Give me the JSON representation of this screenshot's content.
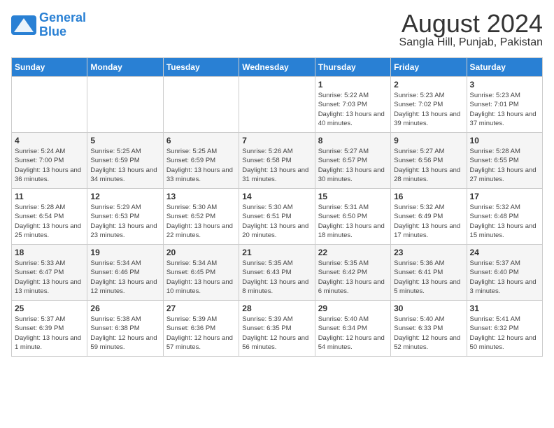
{
  "logo": {
    "line1": "General",
    "line2": "Blue"
  },
  "title": "August 2024",
  "subtitle": "Sangla Hill, Punjab, Pakistan",
  "headers": [
    "Sunday",
    "Monday",
    "Tuesday",
    "Wednesday",
    "Thursday",
    "Friday",
    "Saturday"
  ],
  "weeks": [
    [
      {
        "day": "",
        "sunrise": "",
        "sunset": "",
        "daylight": ""
      },
      {
        "day": "",
        "sunrise": "",
        "sunset": "",
        "daylight": ""
      },
      {
        "day": "",
        "sunrise": "",
        "sunset": "",
        "daylight": ""
      },
      {
        "day": "",
        "sunrise": "",
        "sunset": "",
        "daylight": ""
      },
      {
        "day": "1",
        "sunrise": "Sunrise: 5:22 AM",
        "sunset": "Sunset: 7:03 PM",
        "daylight": "Daylight: 13 hours and 40 minutes."
      },
      {
        "day": "2",
        "sunrise": "Sunrise: 5:23 AM",
        "sunset": "Sunset: 7:02 PM",
        "daylight": "Daylight: 13 hours and 39 minutes."
      },
      {
        "day": "3",
        "sunrise": "Sunrise: 5:23 AM",
        "sunset": "Sunset: 7:01 PM",
        "daylight": "Daylight: 13 hours and 37 minutes."
      }
    ],
    [
      {
        "day": "4",
        "sunrise": "Sunrise: 5:24 AM",
        "sunset": "Sunset: 7:00 PM",
        "daylight": "Daylight: 13 hours and 36 minutes."
      },
      {
        "day": "5",
        "sunrise": "Sunrise: 5:25 AM",
        "sunset": "Sunset: 6:59 PM",
        "daylight": "Daylight: 13 hours and 34 minutes."
      },
      {
        "day": "6",
        "sunrise": "Sunrise: 5:25 AM",
        "sunset": "Sunset: 6:59 PM",
        "daylight": "Daylight: 13 hours and 33 minutes."
      },
      {
        "day": "7",
        "sunrise": "Sunrise: 5:26 AM",
        "sunset": "Sunset: 6:58 PM",
        "daylight": "Daylight: 13 hours and 31 minutes."
      },
      {
        "day": "8",
        "sunrise": "Sunrise: 5:27 AM",
        "sunset": "Sunset: 6:57 PM",
        "daylight": "Daylight: 13 hours and 30 minutes."
      },
      {
        "day": "9",
        "sunrise": "Sunrise: 5:27 AM",
        "sunset": "Sunset: 6:56 PM",
        "daylight": "Daylight: 13 hours and 28 minutes."
      },
      {
        "day": "10",
        "sunrise": "Sunrise: 5:28 AM",
        "sunset": "Sunset: 6:55 PM",
        "daylight": "Daylight: 13 hours and 27 minutes."
      }
    ],
    [
      {
        "day": "11",
        "sunrise": "Sunrise: 5:28 AM",
        "sunset": "Sunset: 6:54 PM",
        "daylight": "Daylight: 13 hours and 25 minutes."
      },
      {
        "day": "12",
        "sunrise": "Sunrise: 5:29 AM",
        "sunset": "Sunset: 6:53 PM",
        "daylight": "Daylight: 13 hours and 23 minutes."
      },
      {
        "day": "13",
        "sunrise": "Sunrise: 5:30 AM",
        "sunset": "Sunset: 6:52 PM",
        "daylight": "Daylight: 13 hours and 22 minutes."
      },
      {
        "day": "14",
        "sunrise": "Sunrise: 5:30 AM",
        "sunset": "Sunset: 6:51 PM",
        "daylight": "Daylight: 13 hours and 20 minutes."
      },
      {
        "day": "15",
        "sunrise": "Sunrise: 5:31 AM",
        "sunset": "Sunset: 6:50 PM",
        "daylight": "Daylight: 13 hours and 18 minutes."
      },
      {
        "day": "16",
        "sunrise": "Sunrise: 5:32 AM",
        "sunset": "Sunset: 6:49 PM",
        "daylight": "Daylight: 13 hours and 17 minutes."
      },
      {
        "day": "17",
        "sunrise": "Sunrise: 5:32 AM",
        "sunset": "Sunset: 6:48 PM",
        "daylight": "Daylight: 13 hours and 15 minutes."
      }
    ],
    [
      {
        "day": "18",
        "sunrise": "Sunrise: 5:33 AM",
        "sunset": "Sunset: 6:47 PM",
        "daylight": "Daylight: 13 hours and 13 minutes."
      },
      {
        "day": "19",
        "sunrise": "Sunrise: 5:34 AM",
        "sunset": "Sunset: 6:46 PM",
        "daylight": "Daylight: 13 hours and 12 minutes."
      },
      {
        "day": "20",
        "sunrise": "Sunrise: 5:34 AM",
        "sunset": "Sunset: 6:45 PM",
        "daylight": "Daylight: 13 hours and 10 minutes."
      },
      {
        "day": "21",
        "sunrise": "Sunrise: 5:35 AM",
        "sunset": "Sunset: 6:43 PM",
        "daylight": "Daylight: 13 hours and 8 minutes."
      },
      {
        "day": "22",
        "sunrise": "Sunrise: 5:35 AM",
        "sunset": "Sunset: 6:42 PM",
        "daylight": "Daylight: 13 hours and 6 minutes."
      },
      {
        "day": "23",
        "sunrise": "Sunrise: 5:36 AM",
        "sunset": "Sunset: 6:41 PM",
        "daylight": "Daylight: 13 hours and 5 minutes."
      },
      {
        "day": "24",
        "sunrise": "Sunrise: 5:37 AM",
        "sunset": "Sunset: 6:40 PM",
        "daylight": "Daylight: 13 hours and 3 minutes."
      }
    ],
    [
      {
        "day": "25",
        "sunrise": "Sunrise: 5:37 AM",
        "sunset": "Sunset: 6:39 PM",
        "daylight": "Daylight: 13 hours and 1 minute."
      },
      {
        "day": "26",
        "sunrise": "Sunrise: 5:38 AM",
        "sunset": "Sunset: 6:38 PM",
        "daylight": "Daylight: 12 hours and 59 minutes."
      },
      {
        "day": "27",
        "sunrise": "Sunrise: 5:39 AM",
        "sunset": "Sunset: 6:36 PM",
        "daylight": "Daylight: 12 hours and 57 minutes."
      },
      {
        "day": "28",
        "sunrise": "Sunrise: 5:39 AM",
        "sunset": "Sunset: 6:35 PM",
        "daylight": "Daylight: 12 hours and 56 minutes."
      },
      {
        "day": "29",
        "sunrise": "Sunrise: 5:40 AM",
        "sunset": "Sunset: 6:34 PM",
        "daylight": "Daylight: 12 hours and 54 minutes."
      },
      {
        "day": "30",
        "sunrise": "Sunrise: 5:40 AM",
        "sunset": "Sunset: 6:33 PM",
        "daylight": "Daylight: 12 hours and 52 minutes."
      },
      {
        "day": "31",
        "sunrise": "Sunrise: 5:41 AM",
        "sunset": "Sunset: 6:32 PM",
        "daylight": "Daylight: 12 hours and 50 minutes."
      }
    ]
  ]
}
